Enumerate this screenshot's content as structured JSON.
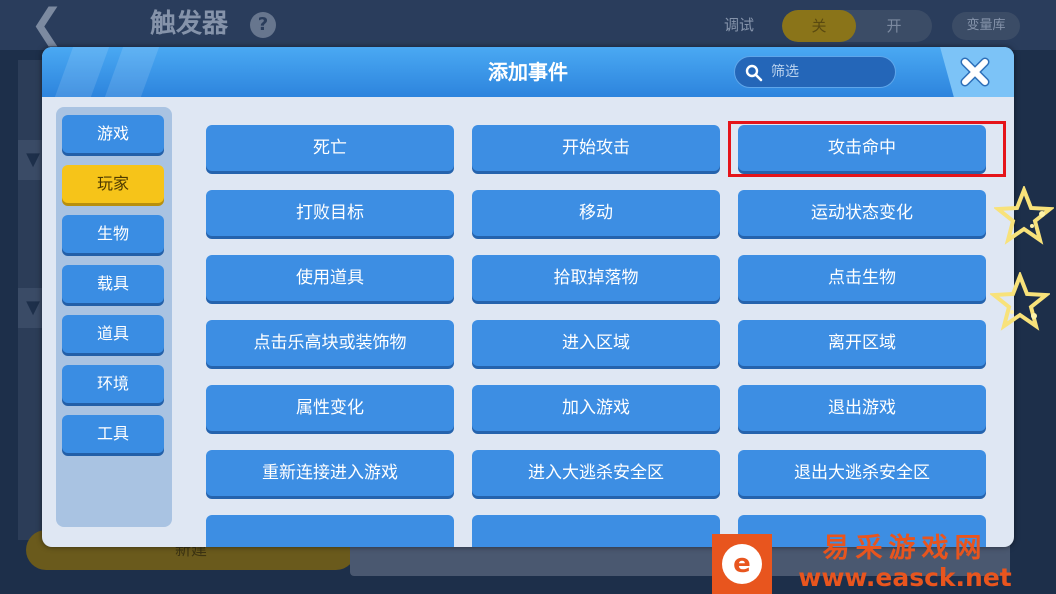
{
  "background": {
    "title": "触发器",
    "help_icon": "?",
    "debug_label": "调试",
    "toggle_off": "关",
    "toggle_on": "开",
    "variable_library": "变量库",
    "new_button": "新建"
  },
  "modal": {
    "title": "添加事件",
    "search_placeholder": "筛选",
    "close_icon": "close-icon"
  },
  "sidebar": {
    "categories": [
      {
        "label": "游戏",
        "active": false
      },
      {
        "label": "玩家",
        "active": true
      },
      {
        "label": "生物",
        "active": false
      },
      {
        "label": "载具",
        "active": false
      },
      {
        "label": "道具",
        "active": false
      },
      {
        "label": "环境",
        "active": false
      },
      {
        "label": "工具",
        "active": false
      }
    ]
  },
  "events": [
    {
      "label": "死亡"
    },
    {
      "label": "开始攻击"
    },
    {
      "label": "攻击命中",
      "highlighted": true
    },
    {
      "label": "打败目标"
    },
    {
      "label": "移动"
    },
    {
      "label": "运动状态变化"
    },
    {
      "label": "使用道具"
    },
    {
      "label": "拾取掉落物"
    },
    {
      "label": "点击生物"
    },
    {
      "label": "点击乐高块或装饰物"
    },
    {
      "label": "进入区域"
    },
    {
      "label": "离开区域"
    },
    {
      "label": "属性变化"
    },
    {
      "label": "加入游戏"
    },
    {
      "label": "退出游戏"
    },
    {
      "label": "重新连接进入游戏"
    },
    {
      "label": "进入大逃杀安全区"
    },
    {
      "label": "退出大逃杀安全区"
    },
    {
      "label": ""
    },
    {
      "label": ""
    },
    {
      "label": ""
    }
  ],
  "colors": {
    "highlight": "#e5141a",
    "active_category": "#f6c419",
    "button": "#3d8ee3"
  },
  "watermark": {
    "logo_char": "e",
    "title": "易采游戏网",
    "url": "www.easck.net"
  }
}
